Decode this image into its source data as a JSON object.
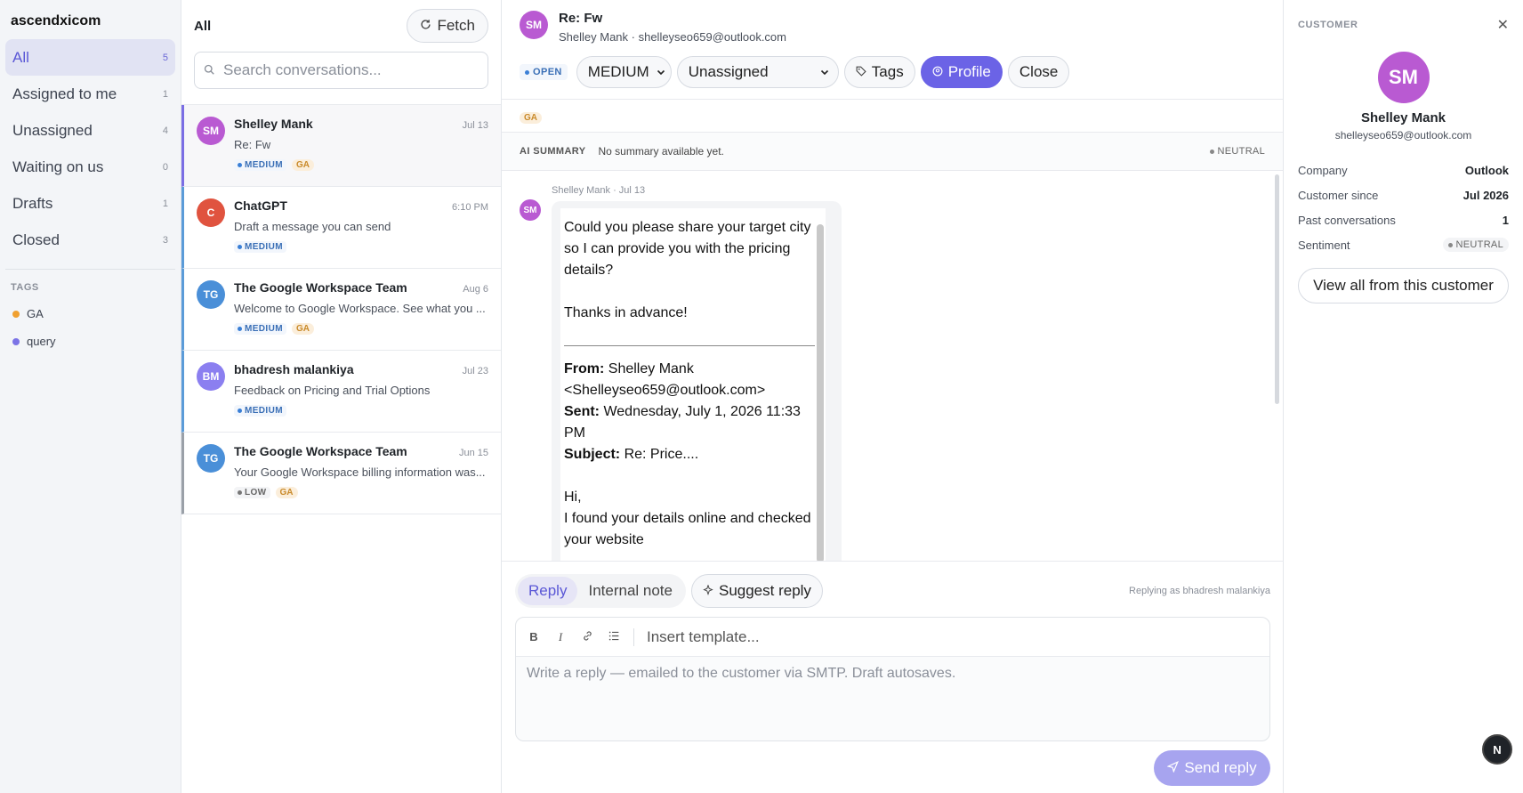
{
  "nav": {
    "brand": "ascendxicom",
    "items": [
      {
        "label": "All",
        "count": "5"
      },
      {
        "label": "Assigned to me",
        "count": "1"
      },
      {
        "label": "Unassigned",
        "count": "4"
      },
      {
        "label": "Waiting on us",
        "count": "0"
      },
      {
        "label": "Drafts",
        "count": "1"
      },
      {
        "label": "Closed",
        "count": "3"
      }
    ],
    "tags_heading": "TAGS",
    "tags": [
      {
        "label": "GA",
        "color": "#f0a030"
      },
      {
        "label": "query",
        "color": "#7b73e6"
      }
    ]
  },
  "list": {
    "title": "All",
    "fetch_label": "Fetch",
    "search_placeholder": "Search conversations...",
    "conversations": [
      {
        "initials": "SM",
        "name": "Shelley Mank",
        "date": "Jul 13",
        "subject": "Re: Fw",
        "priority": "MEDIUM",
        "tag": "GA",
        "avatar_color": "#b95ad2"
      },
      {
        "initials": "C",
        "name": "ChatGPT",
        "date": "6:10 PM",
        "subject": "Draft a message you can send",
        "priority": "MEDIUM",
        "tag": "",
        "avatar_color": "#e0533f"
      },
      {
        "initials": "TG",
        "name": "The Google Workspace Team",
        "date": "Aug 6",
        "subject": "Welcome to Google Workspace. See what you ...",
        "priority": "MEDIUM",
        "tag": "GA",
        "avatar_color": "#4a8fd8"
      },
      {
        "initials": "BM",
        "name": "bhadresh malankiya",
        "date": "Jul 23",
        "subject": "Feedback on Pricing and Trial Options",
        "priority": "MEDIUM",
        "tag": "",
        "avatar_color": "#8b7ff0"
      },
      {
        "initials": "TG",
        "name": "The Google Workspace Team",
        "date": "Jun 15",
        "subject": "Your Google Workspace billing information was...",
        "priority": "LOW",
        "tag": "GA",
        "avatar_color": "#4a8fd8"
      }
    ]
  },
  "thread": {
    "avatar_initials": "SM",
    "title": "Re: Fw",
    "subtitle": "Shelley Mank · shelleyseo659@outlook.com",
    "status": "OPEN",
    "priority_value": "MEDIUM",
    "assignee_value": "Unassigned",
    "tags_label": "Tags",
    "profile_label": "Profile",
    "close_label": "Close",
    "tag": "GA",
    "ai_label": "AI SUMMARY",
    "ai_text": "No summary available yet.",
    "sentiment": "NEUTRAL",
    "message": {
      "meta": "Shelley Mank · Jul 13",
      "initials": "SM",
      "para1": "Could you please share your target city so I can provide you with the pricing details?",
      "para2": "Thanks in advance!",
      "from_label": "From:",
      "from_value": "Shelley  Mank <Shelleyseo659@outlook.com>",
      "sent_label": "Sent:",
      "sent_value": "Wednesday, July 1, 2026 11:33 PM",
      "subject_label": "Subject:",
      "subject_value": "Re: Price....",
      "greeting": "Hi,",
      "body_tail": "I found your details online and checked your website"
    }
  },
  "composer": {
    "tab_reply": "Reply",
    "tab_note": "Internal note",
    "suggest_label": "Suggest reply",
    "replying_as": "Replying as bhadresh malankiya",
    "template_placeholder": "Insert template...",
    "reply_placeholder": "Write a reply — emailed to the customer via SMTP. Draft autosaves.",
    "send_label": "Send reply"
  },
  "customer": {
    "heading": "CUSTOMER",
    "initials": "SM",
    "name": "Shelley Mank",
    "email": "shelleyseo659@outlook.com",
    "fields": [
      {
        "key": "Company",
        "value": "Outlook"
      },
      {
        "key": "Customer since",
        "value": "Jul 2026"
      },
      {
        "key": "Past conversations",
        "value": "1"
      },
      {
        "key": "Sentiment",
        "value": "NEUTRAL"
      }
    ],
    "view_all_label": "View all from this customer"
  },
  "fab_label": "N"
}
